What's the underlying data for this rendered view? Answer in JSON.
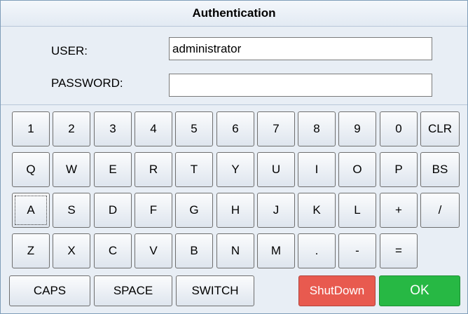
{
  "title": "Authentication",
  "user": {
    "label": "USER:",
    "value": "administrator"
  },
  "password": {
    "label": "PASSWORD:",
    "value": ""
  },
  "rows": [
    [
      "1",
      "2",
      "3",
      "4",
      "5",
      "6",
      "7",
      "8",
      "9",
      "0",
      "CLR"
    ],
    [
      "Q",
      "W",
      "E",
      "R",
      "T",
      "Y",
      "U",
      "I",
      "O",
      "P",
      "BS"
    ],
    [
      "A",
      "S",
      "D",
      "F",
      "G",
      "H",
      "J",
      "K",
      "L",
      "+",
      "/"
    ],
    [
      "Z",
      "X",
      "C",
      "V",
      "B",
      "N",
      "M",
      ".",
      "-",
      "="
    ]
  ],
  "bottom": {
    "caps": "CAPS",
    "space": "SPACE",
    "switch": "SWITCH",
    "shutdown": "ShutDown",
    "ok": "OK"
  },
  "focused_key": "A",
  "colors": {
    "shutdown": "#e85a4f",
    "ok": "#27b844",
    "background": "#e8eef5"
  }
}
